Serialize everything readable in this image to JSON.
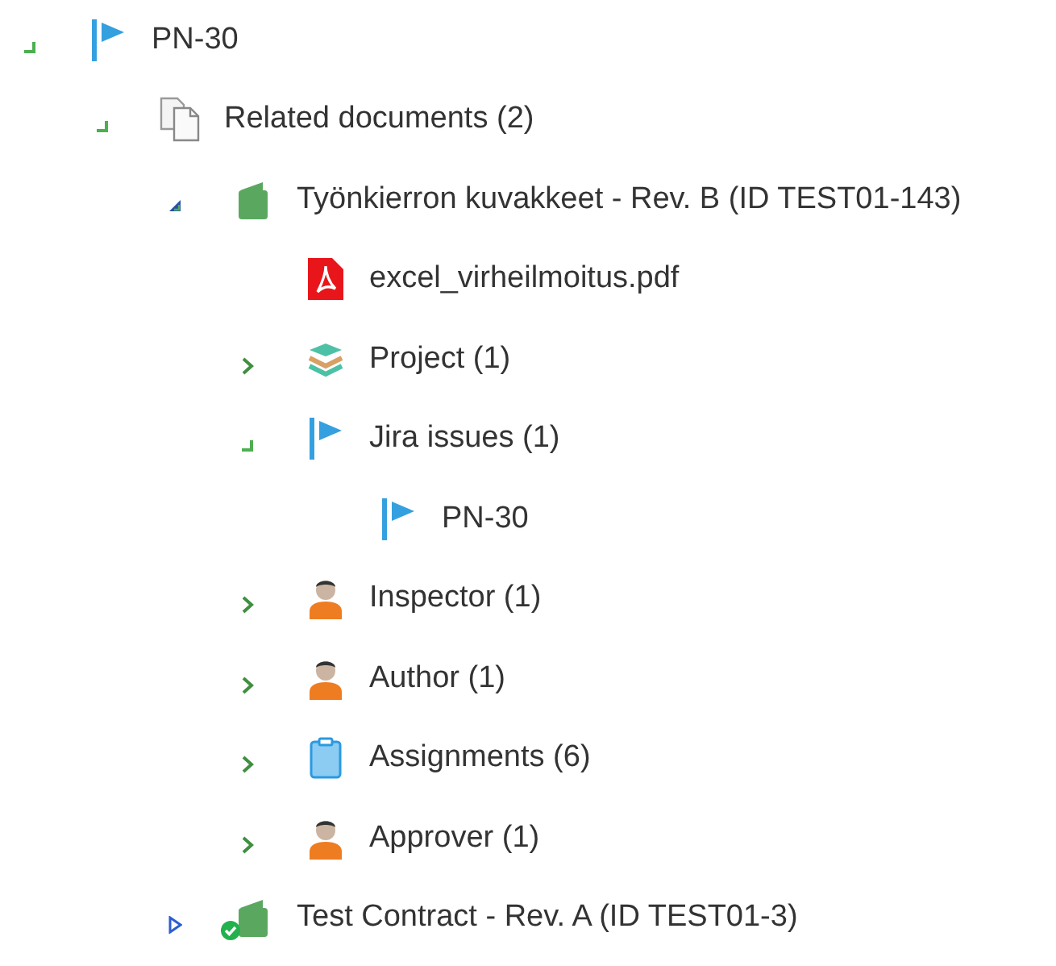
{
  "tree": [
    {
      "label": "PN-30",
      "kind": "flag",
      "expanded": true,
      "children": [
        {
          "label": "Related documents (2)",
          "kind": "documents",
          "expanded": true,
          "children": [
            {
              "label": "Työnkierron kuvakkeet - Rev. B (ID TEST01-143)",
              "kind": "document",
              "expanded": true,
              "approved": false,
              "children": [
                {
                  "label": "excel_virheilmoitus.pdf",
                  "kind": "pdf"
                },
                {
                  "label": "Project (1)",
                  "kind": "project",
                  "expanded": false
                },
                {
                  "label": "Jira issues (1)",
                  "kind": "flag",
                  "expanded": true,
                  "children": [
                    {
                      "label": "PN-30",
                      "kind": "flag"
                    }
                  ]
                },
                {
                  "label": "Inspector (1)",
                  "kind": "person",
                  "expanded": false
                },
                {
                  "label": "Author (1)",
                  "kind": "person",
                  "expanded": false
                },
                {
                  "label": "Assignments (6)",
                  "kind": "assignments",
                  "expanded": false
                },
                {
                  "label": "Approver (1)",
                  "kind": "person",
                  "expanded": false
                }
              ]
            },
            {
              "label": "Test Contract - Rev. A (ID TEST01-3)",
              "kind": "document",
              "expanded": false,
              "approved": true
            }
          ]
        }
      ]
    }
  ]
}
